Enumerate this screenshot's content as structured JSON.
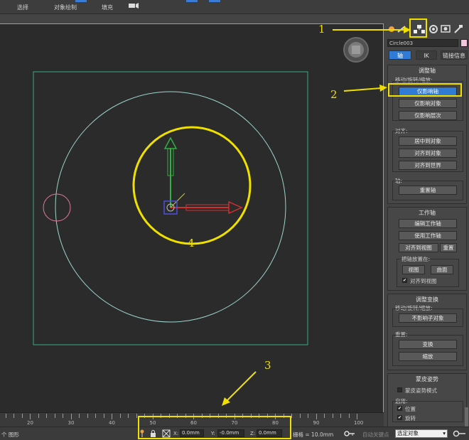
{
  "menubar": {
    "items": [
      "选择",
      "对象绘制",
      "填充"
    ]
  },
  "panel": {
    "object_name": "Circle003",
    "color_swatch": "#f2c6dc",
    "subtabs": [
      "轴",
      "IK",
      "链接信息"
    ],
    "adjust_pivot": {
      "title": "调整轴",
      "move_label": "移动/旋转/缩放:",
      "btn_affect_pivot": "仅影响轴",
      "btn_affect_object": "仅影响对象",
      "btn_affect_hierarchy": "仅影响层次",
      "align_label": "对齐:",
      "btn_center_to_object": "居中到对象",
      "btn_align_to_object": "对齐到对象",
      "btn_align_to_world": "对齐到世界",
      "pivot_label": "轴:",
      "btn_reset_pivot": "重置轴"
    },
    "working_pivot": {
      "title": "工作轴",
      "btn_edit": "编辑工作轴",
      "btn_use": "使用工作轴",
      "btn_align_to_view": "对齐到视图",
      "btn_reset": "重置",
      "place_label": "把轴放置在:",
      "btn_view": "视图",
      "btn_surface": "曲面",
      "chk_align_to_view": "对齐到视图"
    },
    "adjust_transform": {
      "title": "调整变换",
      "move_label": "移动/旋转/缩放:",
      "btn_dont_affect_children": "不影响子对象",
      "reset_label": "重置:",
      "btn_transform": "变换",
      "btn_scale": "缩放"
    },
    "skin_pose": {
      "title": "蒙皮姿势",
      "chk_skin_pose_mode": "蒙皮姿势模式",
      "enable_label": "启用:",
      "chk_position": "位置",
      "chk_rotation": "旋转"
    }
  },
  "timeline": {
    "labels": [
      "20",
      "30",
      "40",
      "50",
      "60",
      "70",
      "80",
      "90",
      "100"
    ]
  },
  "statusbar": {
    "selection_info": "个 图形",
    "x_label": "X:",
    "x_value": "0.0mm",
    "y_label": "Y:",
    "y_value": "-0.0mm",
    "z_label": "Z:",
    "z_value": "0.0mm",
    "grid_info": "栅格 = 10.0mm",
    "autokey_label": "自动关键点",
    "selection_dropdown": "选定对象"
  },
  "annotations": {
    "n1": "1",
    "n2": "2",
    "n3": "3",
    "n4": "4"
  },
  "colors": {
    "accent_yellow": "#f0e000",
    "active_blue": "#2f7bd6",
    "viewport_bg": "#2b2b2b",
    "gizmo_red": "#d03030",
    "gizmo_green": "#30b040",
    "circle_line": "#9cd4cc"
  }
}
